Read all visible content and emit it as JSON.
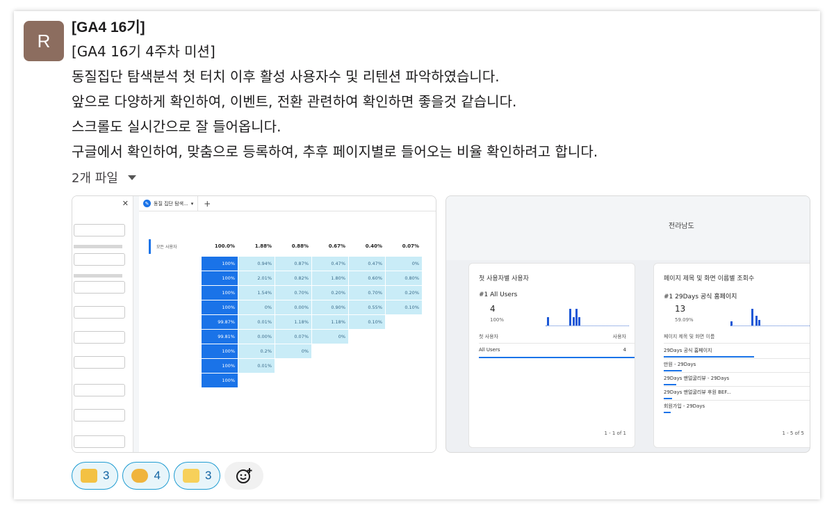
{
  "avatar": {
    "initial": "R",
    "color": "#8c6d5f"
  },
  "message": {
    "sender": "[GA4 16기]",
    "lines": [
      "[GA4 16기 4주차 미션]",
      "동질집단 탐색분석 첫 터치 이후 활성 사용자수 및 리텐션 파악하였습니다.",
      "앞으로 다양하게 확인하여, 이벤트, 전환 관련하여 확인하면 좋을것 같습니다.",
      "스크롤도 실시간으로 잘 들어옵니다.",
      "구글에서 확인하여, 맞춤으로 등록하여, 추후 페이지별로 들어오는 비율 확인하려고 합니다."
    ],
    "files_label": "2개 파일"
  },
  "attachment1": {
    "tab_label": "동질 집단 탐색...",
    "total_label": "모든 사용자",
    "total_row": [
      "100.0%",
      "1.88%",
      "0.88%",
      "0.67%",
      "0.40%",
      "0.07%"
    ],
    "rows": [
      [
        "100%",
        "0.94%",
        "0.87%",
        "0.47%",
        "0.47%",
        "0%"
      ],
      [
        "100%",
        "2.01%",
        "0.82%",
        "1.80%",
        "0.60%",
        "0.80%"
      ],
      [
        "100%",
        "1.54%",
        "0.70%",
        "0.20%",
        "0.70%",
        "0.20%"
      ],
      [
        "100%",
        "0%",
        "0.00%",
        "0.90%",
        "0.55%",
        "0.10%"
      ],
      [
        "99.87%",
        "0.01%",
        "1.18%",
        "1.18%",
        "0.10%"
      ],
      [
        "99.81%",
        "0.00%",
        "0.07%",
        "0%"
      ],
      [
        "100%",
        "0.2%",
        "0%"
      ],
      [
        "100%",
        "0.01%"
      ],
      [
        "100%"
      ]
    ]
  },
  "attachment2": {
    "map_label": "전라남도",
    "card1": {
      "title": "첫 사용자별 사용자",
      "rank": "#1  All Users",
      "value": "4",
      "pct": "100%",
      "col_left": "첫 사용자",
      "col_right": "사용자",
      "row_label": "All Users",
      "row_value": "4",
      "pager": "1 - 1 of 1"
    },
    "card2": {
      "title": "페이지 제목 및 화면 이름별 조회수",
      "rank": "#1  29Days 공식 홈페이지",
      "value": "13",
      "pct": "59.09%",
      "col_left": "페이지 제목 및 화면 이름",
      "rows": [
        "29Days 공식 홈페이지",
        "만원 - 29Days",
        "29Days 맨얼굴리뷰 - 29Days",
        "29Days 맨얼굴리뷰 후원 BEF...",
        "회원가입 - 29Days"
      ],
      "pager": "1 - 5 of 5"
    }
  },
  "reactions": [
    {
      "icon": "clapping-emoji",
      "count": "3"
    },
    {
      "icon": "happy-blob-emoji",
      "count": "4"
    },
    {
      "icon": "laptop-emoji",
      "count": "3"
    }
  ],
  "colors": {
    "accent": "#1a73e8",
    "reaction_border": "#1d9bd1",
    "reaction_text": "#1264a3"
  }
}
